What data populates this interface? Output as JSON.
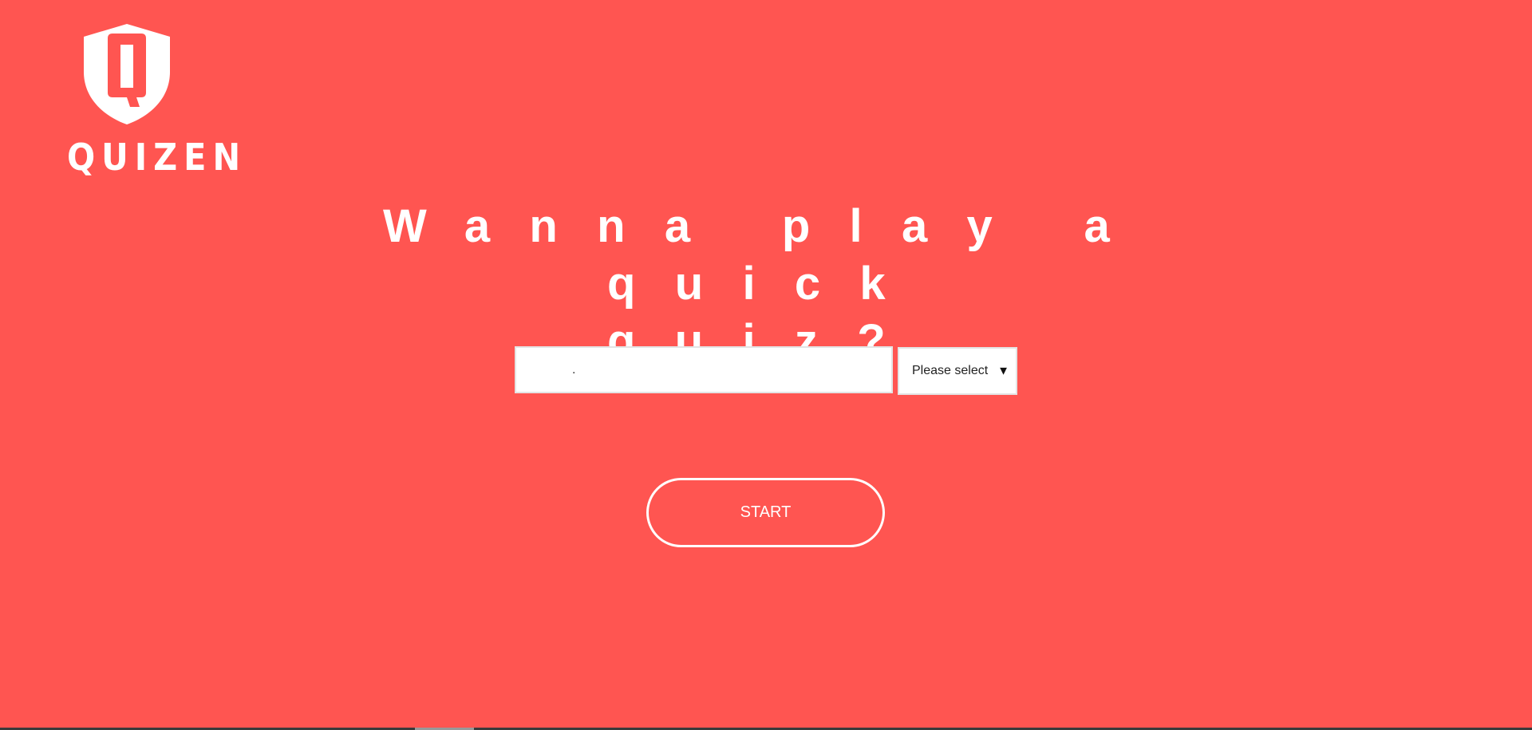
{
  "brand": {
    "logo_letter": "Q",
    "logo_text": "QUIZEN"
  },
  "hero": {
    "line1": "Wanna play a quick",
    "line2": "quiz?"
  },
  "form": {
    "name_value": ".",
    "select_value": "Please select",
    "select_arrow": "▼"
  },
  "actions": {
    "start_label": "START"
  },
  "colors": {
    "background": "#ff5551",
    "foreground": "#ffffff"
  }
}
